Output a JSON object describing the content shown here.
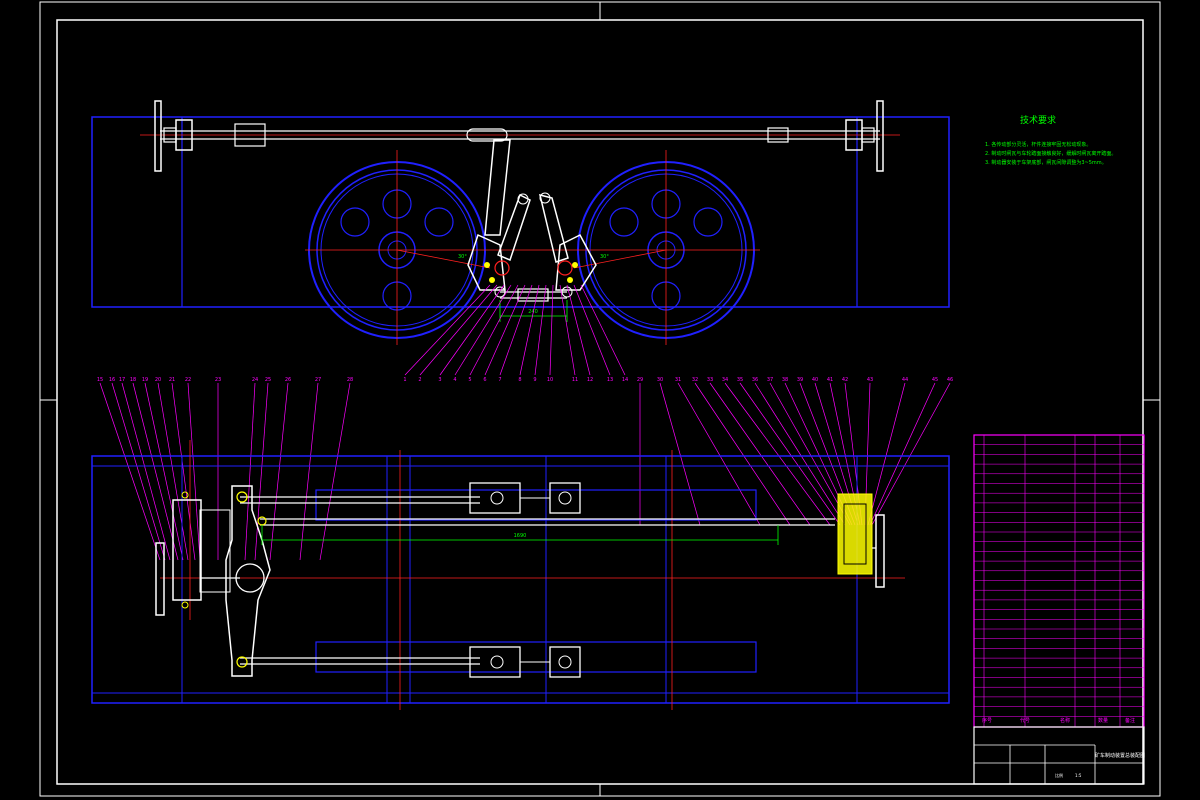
{
  "technical_requirements": {
    "title": "技术要求",
    "notes": [
      "1. 各传动部分灵活，杆件连接牢固无松动现象。",
      "2. 制动时闸瓦与车轮踏面接触良好，缓解时闸瓦离开踏面。",
      "3. 制动器安装于车架底部，闸瓦间隙调整为3~5mm。"
    ]
  },
  "dimensions": {
    "angle_left": "30°",
    "angle_right": "30°",
    "center_span": "240",
    "rod_span": "1690"
  },
  "balloons_top": [
    "1",
    "2",
    "3",
    "4",
    "5",
    "6",
    "7",
    "8",
    "9",
    "10",
    "11",
    "12",
    "13",
    "14"
  ],
  "balloons_bottom": [
    "15",
    "16",
    "17",
    "18",
    "19",
    "20",
    "21",
    "22",
    "23",
    "24",
    "25",
    "26",
    "27",
    "28",
    "29",
    "30",
    "31",
    "32",
    "33",
    "34",
    "35",
    "36",
    "37",
    "38",
    "39",
    "40",
    "41",
    "42",
    "43",
    "44",
    "45",
    "46"
  ],
  "title_block": {
    "drawing_name": "矿车制动装置总装配图",
    "footer_labels": [
      "序号",
      "代号",
      "名称",
      "数量",
      "备注"
    ],
    "scale_label": "比例",
    "scale_value": "1:5"
  },
  "colors": {
    "frame": "#ffffff",
    "outline": "#2020ff",
    "center": "#ff2020",
    "leader": "#ff00ff",
    "dim": "#00ff00",
    "part": "#ffffff",
    "highlight": "#ffff00"
  }
}
